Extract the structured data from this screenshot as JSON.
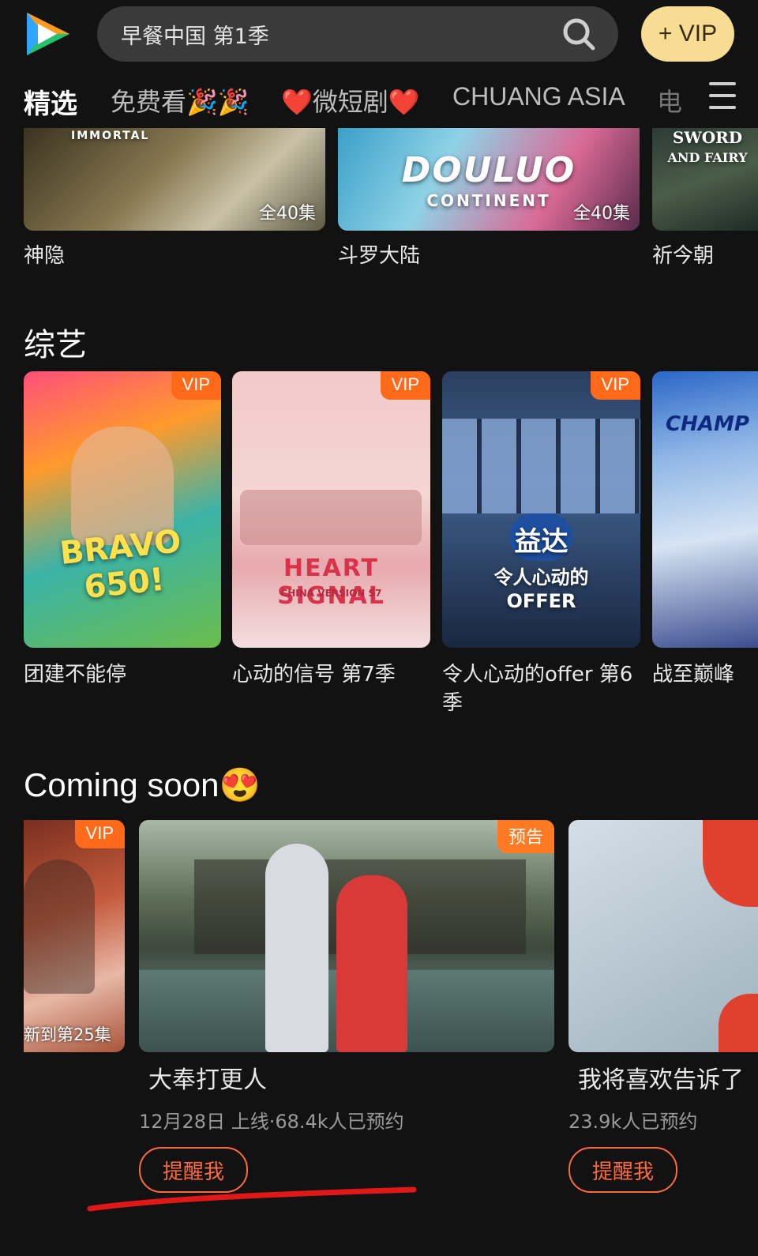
{
  "header": {
    "search_placeholder": "早餐中国 第1季",
    "vip_button": "+ VIP",
    "icons": [
      "tencent-video-logo-icon",
      "search-icon"
    ]
  },
  "tabs": [
    "精选",
    "免费看🎉🎉",
    "❤️微短剧❤️",
    "CHUANG ASIA",
    "电"
  ],
  "row1": [
    {
      "title": "神隐",
      "badge": "全40集",
      "poster_text": "IMMORTAL"
    },
    {
      "title": "斗罗大陆",
      "badge": "全40集",
      "poster_text": "DOULUO",
      "poster_sub": "CONTINENT"
    },
    {
      "title": "祈今朝",
      "poster_text": "SWORD",
      "poster_sub": "AND FAIRY"
    }
  ],
  "variety": {
    "title": "综艺",
    "items": [
      {
        "title": "团建不能停",
        "tag": "VIP",
        "poster_text": "BRAVO 650!"
      },
      {
        "title": "心动的信号 第7季",
        "tag": "VIP",
        "poster_text": "HEART SIGNAL",
        "poster_sub": "CHINA VERSION S7"
      },
      {
        "title": "令人心动的offer 第6季",
        "tag": "VIP",
        "poster_text": "益达",
        "poster_sub": "令人心动的 OFFER"
      },
      {
        "title": "战至巅峰",
        "poster_text": "CHAMP"
      }
    ]
  },
  "coming_soon": {
    "title": "Coming soon😍",
    "items": [
      {
        "tag": "VIP",
        "badge": "新到第25集"
      },
      {
        "tag": "预告",
        "title": "大奉打更人",
        "meta": "12月28日 上线·68.4k人已预约",
        "remind": "提醒我"
      },
      {
        "title": "我将喜欢告诉了",
        "meta": "23.9k人已预约",
        "remind": "提醒我"
      }
    ]
  },
  "colors": {
    "background": "#121212",
    "accent_orange": "#ff6a1a",
    "vip_gold": "#f7dc93",
    "annotation_red": "#e01818"
  }
}
